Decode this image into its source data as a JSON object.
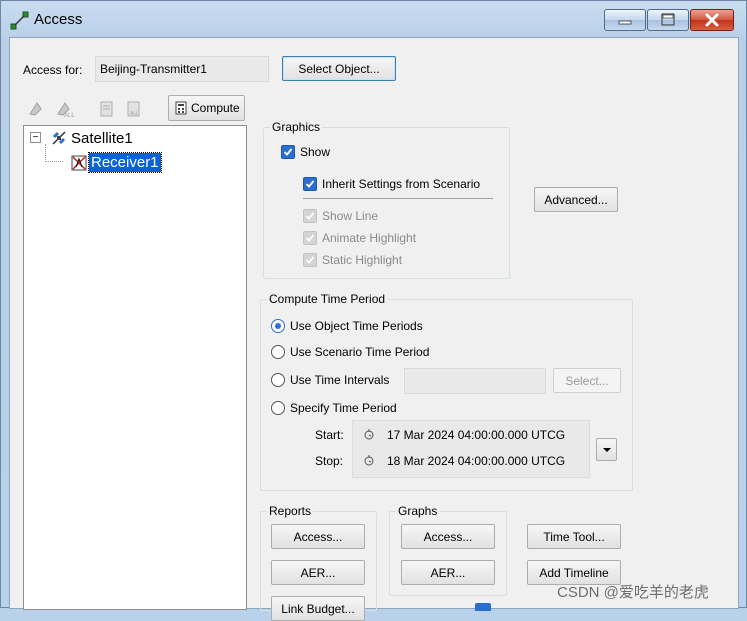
{
  "window": {
    "title": "Access",
    "icon": "access-link-icon"
  },
  "access_for": {
    "label": "Access for:",
    "value": "Beijing-Transmitter1",
    "select_button": "Select Object..."
  },
  "toolbar": {
    "compute_label": "Compute",
    "icons": [
      "access-on-icon",
      "access-off-icon",
      "report-icon",
      "graph-icon",
      "compute-icon"
    ]
  },
  "tree": {
    "root": {
      "label": "Satellite1",
      "icon": "satellite-icon",
      "expander": "⊟"
    },
    "child": {
      "label": "Receiver1",
      "icon": "receiver-icon",
      "selected": true
    }
  },
  "graphics": {
    "title": "Graphics",
    "show": {
      "label": "Show",
      "checked": true
    },
    "inherit": {
      "label": "Inherit Settings from Scenario",
      "checked": true
    },
    "show_line": {
      "label": "Show Line",
      "checked": true,
      "disabled": true
    },
    "animate_highlight": {
      "label": "Animate Highlight",
      "checked": true,
      "disabled": true
    },
    "static_highlight": {
      "label": "Static Highlight",
      "checked": true,
      "disabled": true
    },
    "advanced_button": "Advanced..."
  },
  "compute_time": {
    "title": "Compute Time Period",
    "options": [
      {
        "label": "Use Object Time Periods",
        "selected": true
      },
      {
        "label": "Use Scenario Time Period",
        "selected": false
      },
      {
        "label": "Use Time Intervals",
        "selected": false
      },
      {
        "label": "Specify Time Period",
        "selected": false
      }
    ],
    "select_button": "Select...",
    "start_label": "Start:",
    "start_value": "17 Mar 2024 04:00:00.000 UTCG",
    "stop_label": "Stop:",
    "stop_value": "18 Mar 2024 04:00:00.000 UTCG"
  },
  "reports": {
    "title": "Reports",
    "buttons": [
      "Access...",
      "AER...",
      "Link Budget..."
    ]
  },
  "graphs": {
    "title": "Graphs",
    "buttons": [
      "Access...",
      "AER..."
    ]
  },
  "extra_buttons": [
    "Time Tool...",
    "Add Timeline"
  ],
  "watermark": "CSDN @爱吃羊的老虎",
  "colors": {
    "accent": "#2a6ecf",
    "selection": "#0a63d6",
    "window_frame": "#b9d1ea",
    "close": "#c2331b"
  }
}
